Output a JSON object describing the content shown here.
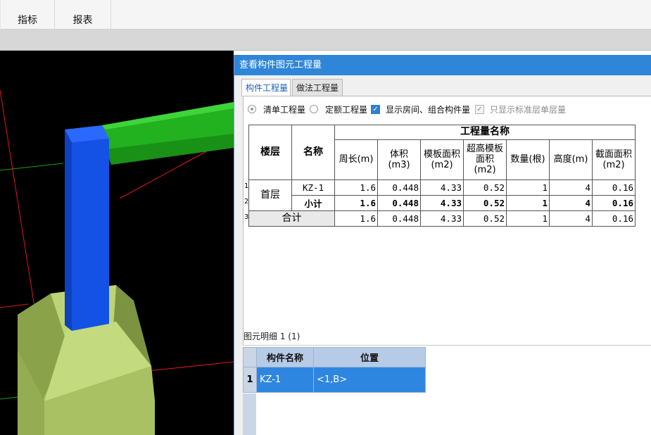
{
  "menu": {
    "items": [
      "指标",
      "报表"
    ]
  },
  "dialog": {
    "title": "查看构件图元工程量",
    "tabs": [
      "构件工程量",
      "做法工程量"
    ],
    "options": {
      "radio_list": "清单工程量",
      "radio_quota": "定额工程量",
      "check_show_rooms": "显示房间、组合构件量",
      "check_standard_floor": "只显示标准层单层量"
    },
    "table": {
      "group_header": "工程量名称",
      "col_floor": "楼层",
      "col_name": "名称",
      "columns": [
        "周长(m)",
        "体积(m3)",
        "模板面积(m2)",
        "超高模板面积(m2)",
        "数量(根)",
        "高度(m)",
        "截面面积(m2)"
      ],
      "row_numbers": [
        "1",
        "2",
        "3"
      ],
      "rows": [
        {
          "floor": "首层",
          "name": "KZ-1",
          "values": [
            "1.6",
            "0.448",
            "4.33",
            "0.52",
            "1",
            "4",
            "0.16"
          ]
        },
        {
          "floor": "",
          "name": "小计",
          "values": [
            "1.6",
            "0.448",
            "4.33",
            "0.52",
            "1",
            "4",
            "0.16"
          ]
        },
        {
          "floor": "合计",
          "name": "",
          "values": [
            "1.6",
            "0.448",
            "4.33",
            "0.52",
            "1",
            "4",
            "0.16"
          ]
        }
      ]
    },
    "detail": {
      "label": "图元明细  1 (1)",
      "headers": [
        "构件名称",
        "位置"
      ],
      "row_number": "1",
      "row": {
        "name": "KZ-1",
        "position": "<1,B>"
      }
    }
  },
  "colors": {
    "title_bar": "#2f86d8",
    "column": "#1452e6",
    "beam": "#22b11f",
    "footing": "#b3cd6b",
    "selected_row": "#2f86e0"
  }
}
